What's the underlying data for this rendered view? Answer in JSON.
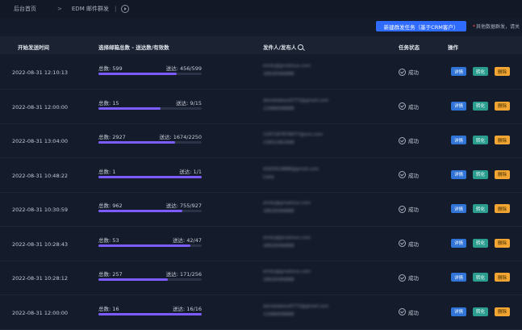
{
  "header": {
    "breadcrumb_home": "后台首页",
    "breadcrumb_sep": ">",
    "breadcrumb_current": "EDM 邮件群发",
    "pipe": "|"
  },
  "toolbar": {
    "new_task_label": "新建群发任务（基于CRM客户）",
    "tip_star": "*",
    "tip_text": "其他数据群发，请关"
  },
  "table": {
    "columns": [
      "开始发送时间",
      "选择邮箱总数 - 送达数/有效数",
      "发件人/发布人",
      "任务状态",
      "操作"
    ],
    "rows": [
      {
        "time": "2022-08-31 12:10:13",
        "total": "总数: 599",
        "delivered": "送达: 456/599",
        "progress": 0.76,
        "sender_line1": "emily@gmailxxx.com",
        "sender_line2": "18928366888",
        "status": "成功"
      },
      {
        "time": "2022-08-31 12:00:00",
        "total": "总数: 15",
        "delivered": "送达: 9/15",
        "progress": 0.6,
        "sender_line1": "danielabeso0773@gmail.com",
        "sender_line2": "12986698888",
        "status": "成功"
      },
      {
        "time": "2022-08-31 13:04:00",
        "total": "总数: 2927",
        "delivered": "送达: 1674/2250",
        "progress": 0.74,
        "sender_line1": "1187187876877@xxx.com",
        "sender_line2": "13651461698",
        "status": "成功"
      },
      {
        "time": "2022-08-31 10:48:22",
        "total": "总数: 1",
        "delivered": "送达: 1/1",
        "progress": 1.0,
        "sender_line1": "4183914888@gmail.com",
        "sender_line2": "Celia",
        "status": "成功"
      },
      {
        "time": "2022-08-31 10:30:59",
        "total": "总数: 962",
        "delivered": "送达: 755/927",
        "progress": 0.81,
        "sender_line1": "emily@gmailxxx.com",
        "sender_line2": "18928366888",
        "status": "成功"
      },
      {
        "time": "2022-08-31 10:28:43",
        "total": "总数: 53",
        "delivered": "送达: 42/47",
        "progress": 0.89,
        "sender_line1": "emily@gmailxxx.com",
        "sender_line2": "18928366888",
        "status": "成功"
      },
      {
        "time": "2022-08-31 10:28:12",
        "total": "总数: 257",
        "delivered": "送达: 171/256",
        "progress": 0.67,
        "sender_line1": "emily@gmailxxx.com",
        "sender_line2": "18928366888",
        "status": "成功"
      },
      {
        "time": "2022-08-31 12:00:00",
        "total": "总数: 16",
        "delivered": "送达: 16/16",
        "progress": 1.0,
        "sender_line1": "danielabeso0773@gmail.com",
        "sender_line2": "12986698888",
        "status": "成功"
      }
    ],
    "op_detail": "详情",
    "op_convert": "转化",
    "op_delete": "删除"
  },
  "colors": {
    "background": "#141b2b",
    "primary_button": "#2f6bff",
    "progress": "#7c5cff",
    "detail": "#2f74d6",
    "convert": "#2a9d8f",
    "delete": "#f2a533"
  }
}
